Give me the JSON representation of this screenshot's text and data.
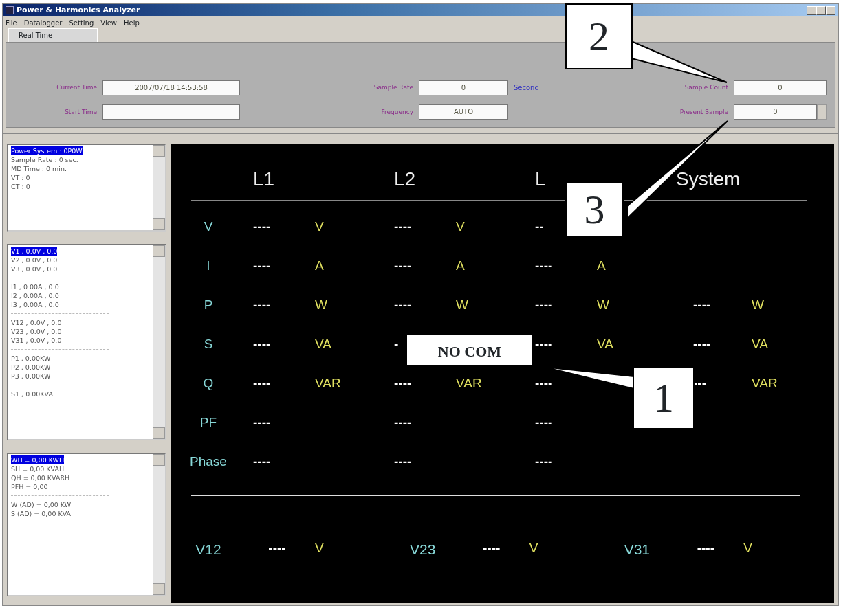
{
  "window": {
    "title": "Power & Harmonics Analyzer"
  },
  "menu": [
    "File",
    "Datalogger",
    "Setting",
    "View",
    "Help"
  ],
  "tabs": [
    {
      "label": "Real Time",
      "selected": true
    }
  ],
  "fields": {
    "current_time": {
      "label": "Current Time",
      "value": "2007/07/18 14:53:58"
    },
    "start_time": {
      "label": "Start Time"
    },
    "sample_rate": {
      "label": "Sample Rate",
      "value": "0",
      "unit": "Second"
    },
    "frequency": {
      "label": "Frequency",
      "value": "AUTO"
    },
    "sample_count": {
      "label": "Sample Count",
      "value": "0"
    },
    "present_sample": {
      "label": "Present Sample",
      "value": "0"
    }
  },
  "lists": [
    [
      {
        "text": "Power System : 0P0W",
        "selected": true
      },
      {
        "text": "Sample Rate : 0 sec.",
        "selected": false
      },
      {
        "text": "MD Time : 0 min.",
        "selected": false
      },
      {
        "text": "VT : 0",
        "selected": false
      },
      {
        "text": "CT : 0",
        "selected": false
      }
    ],
    [
      {
        "text": "V1 , 0.0V , 0.0",
        "selected": true
      },
      {
        "text": "V2 , 0.0V , 0.0",
        "selected": false
      },
      {
        "text": "V3 , 0.0V , 0.0",
        "selected": false
      },
      {
        "kind": "separator"
      },
      {
        "text": "I1 , 0.00A , 0.0",
        "selected": false
      },
      {
        "text": "I2 , 0.00A , 0.0",
        "selected": false
      },
      {
        "text": "I3 , 0.00A , 0.0",
        "selected": false
      },
      {
        "kind": "separator"
      },
      {
        "text": "V12 , 0.0V , 0.0",
        "selected": false
      },
      {
        "text": "V23 , 0.0V , 0.0",
        "selected": false
      },
      {
        "text": "V31 , 0.0V , 0.0",
        "selected": false
      },
      {
        "kind": "separator"
      },
      {
        "text": "P1 , 0.00KW",
        "selected": false
      },
      {
        "text": "P2 , 0.00KW",
        "selected": false
      },
      {
        "text": "P3 , 0.00KW",
        "selected": false
      },
      {
        "kind": "separator"
      },
      {
        "text": "S1 , 0.00KVA",
        "selected": false
      }
    ],
    [
      {
        "text": "WH = 0,00 KWH",
        "selected": true
      },
      {
        "text": "SH = 0,00 KVAH",
        "selected": false
      },
      {
        "text": "QH = 0,00 KVARH",
        "selected": false
      },
      {
        "text": "PFH = 0,00",
        "selected": false
      },
      {
        "kind": "separator"
      },
      {
        "text": "W (AD) = 0,00 KW",
        "selected": false
      },
      {
        "text": "S (AD) = 0,00 KVA",
        "selected": false
      }
    ]
  ],
  "display": {
    "columns": [
      "L1",
      "L2",
      "L",
      "System"
    ],
    "rows": [
      {
        "label": "V",
        "cells": [
          {
            "value": "----",
            "unit": "V"
          },
          {
            "value": "----",
            "unit": "V"
          },
          {
            "value": "--"
          },
          {}
        ]
      },
      {
        "label": "I",
        "cells": [
          {
            "value": "----",
            "unit": "A"
          },
          {
            "value": "----",
            "unit": "A"
          },
          {
            "value": "----",
            "unit": "A"
          },
          {}
        ]
      },
      {
        "label": "P",
        "cells": [
          {
            "value": "----",
            "unit": "W"
          },
          {
            "value": "----",
            "unit": "W"
          },
          {
            "value": "----",
            "unit": "W"
          },
          {
            "value": "----",
            "unit": "W"
          }
        ]
      },
      {
        "label": "S",
        "cells": [
          {
            "value": "----",
            "unit": "VA"
          },
          {
            "value": "-"
          },
          {
            "value": "----",
            "unit": "VA"
          },
          {
            "value": "----",
            "unit": "VA"
          }
        ]
      },
      {
        "label": "Q",
        "cells": [
          {
            "value": "----",
            "unit": "VAR"
          },
          {
            "value": "----",
            "unit": "VAR"
          },
          {
            "value": "----"
          },
          {
            "value": "---",
            "unit": "VAR"
          }
        ]
      },
      {
        "label": "PF",
        "cells": [
          {
            "value": "----"
          },
          {
            "value": "----"
          },
          {
            "value": "----"
          },
          {}
        ]
      },
      {
        "label": "Phase",
        "cells": [
          {
            "value": "----"
          },
          {
            "value": "----"
          },
          {
            "value": "----"
          },
          {}
        ]
      }
    ],
    "line_voltages": [
      {
        "label": "V12",
        "value": "----",
        "unit": "V"
      },
      {
        "label": "V23",
        "value": "----",
        "unit": "V"
      },
      {
        "label": "V31",
        "value": "----",
        "unit": "V"
      }
    ]
  },
  "status_label": "NO COM",
  "callouts": [
    {
      "label": "1"
    },
    {
      "label": "2"
    },
    {
      "label": "3"
    }
  ]
}
